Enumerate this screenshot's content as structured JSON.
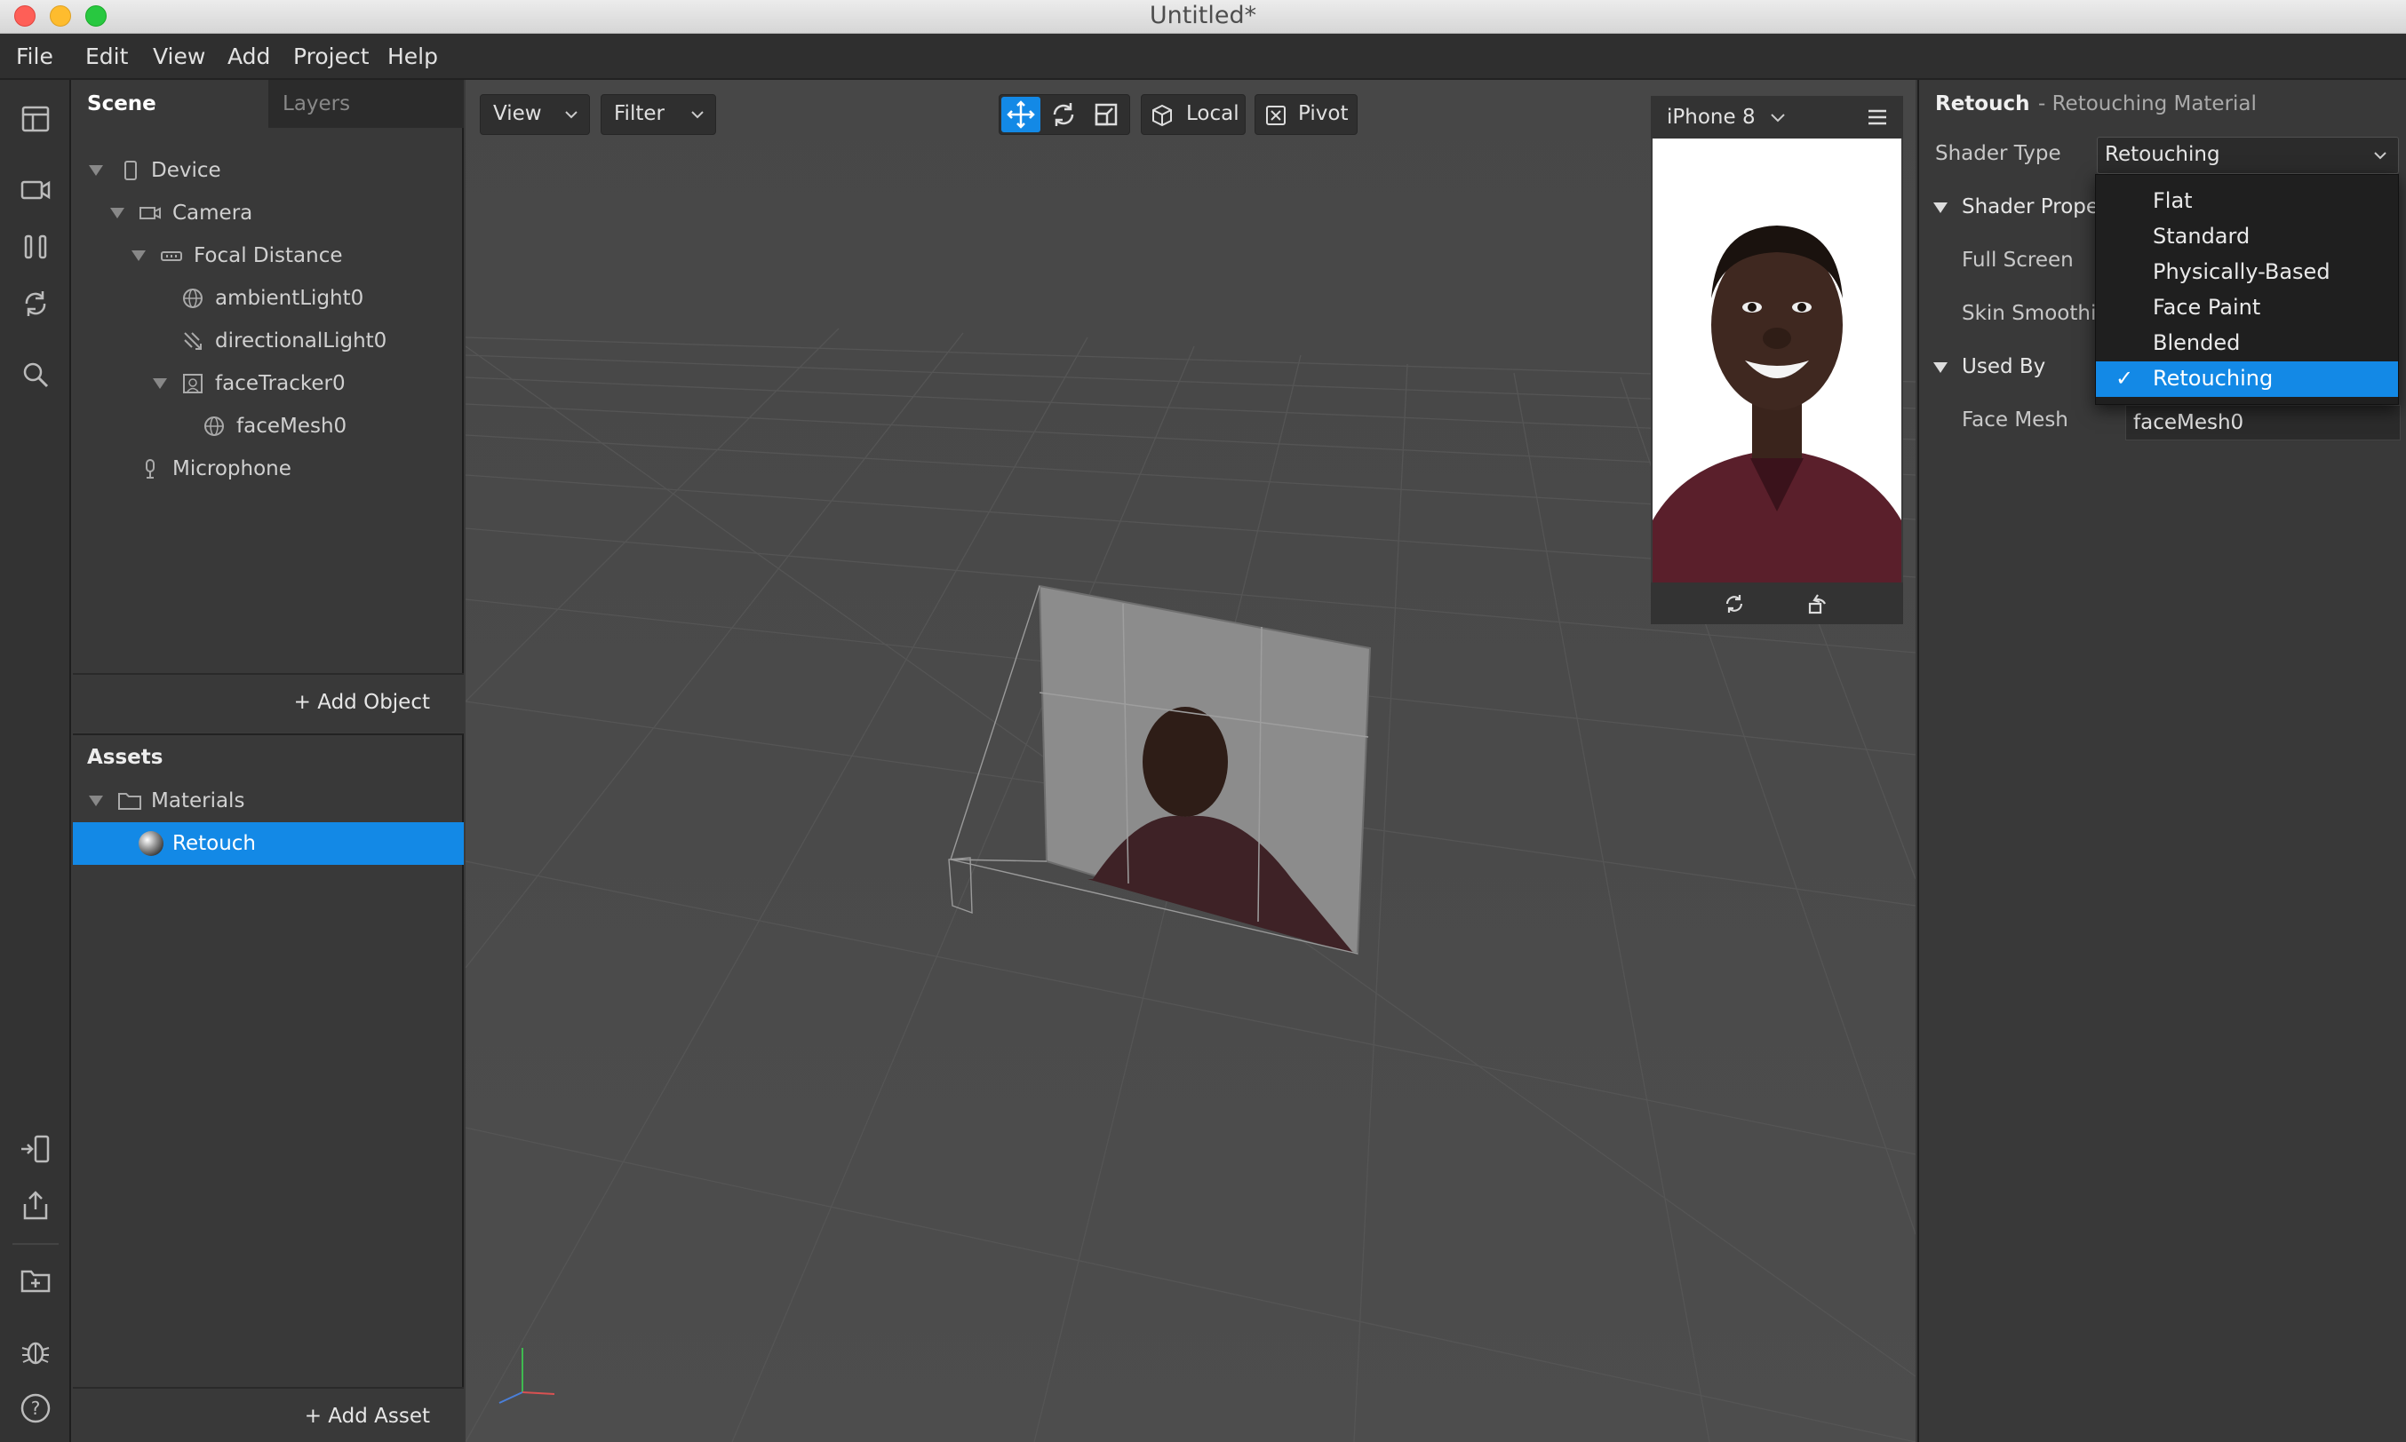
{
  "window": {
    "title": "Untitled*"
  },
  "menu": [
    "File",
    "Edit",
    "View",
    "Add",
    "Project",
    "Help"
  ],
  "left_toolbar": {
    "icons": [
      "layout-icon",
      "video-camera-icon",
      "pause-bars-icon",
      "refresh-icon",
      "search-icon",
      "device-import-icon",
      "share-icon",
      "add-folder-icon",
      "bug-icon",
      "help-icon"
    ]
  },
  "scene": {
    "tabs": {
      "scene": "Scene",
      "layers": "Layers"
    },
    "tree": [
      {
        "label": "Device",
        "icon": "device-icon"
      },
      {
        "label": "Camera",
        "icon": "camera-icon"
      },
      {
        "label": "Focal Distance",
        "icon": "focal-distance-icon"
      },
      {
        "label": "ambientLight0",
        "icon": "ambient-light-icon"
      },
      {
        "label": "directionalLight0",
        "icon": "directional-light-icon"
      },
      {
        "label": "faceTracker0",
        "icon": "face-tracker-icon"
      },
      {
        "label": "faceMesh0",
        "icon": "face-mesh-icon"
      },
      {
        "label": "Microphone",
        "icon": "microphone-icon"
      }
    ],
    "add_object": "Add Object"
  },
  "assets": {
    "title": "Assets",
    "folder": "Materials",
    "item": "Retouch",
    "add_asset": "Add Asset"
  },
  "viewport": {
    "view_label": "View",
    "filter_label": "Filter",
    "local_label": "Local",
    "pivot_label": "Pivot",
    "accent": "#1389e6"
  },
  "device": {
    "name": "iPhone 8"
  },
  "inspector": {
    "object_name": "Retouch",
    "object_type": "- Retouching Material",
    "shader_type_label": "Shader Type",
    "shader_type_value": "Retouching",
    "shader_properties_label": "Shader Proper",
    "full_screen_label": "Full Screen",
    "skin_smoothing_label": "Skin Smoothin",
    "used_by_label": "Used By",
    "face_mesh_label": "Face Mesh",
    "face_mesh_value": "faceMesh0",
    "dropdown_options": [
      "Flat",
      "Standard",
      "Physically-Based",
      "Face Paint",
      "Blended",
      "Retouching"
    ],
    "dropdown_selected_index": 5,
    "selected_check": "✓"
  }
}
